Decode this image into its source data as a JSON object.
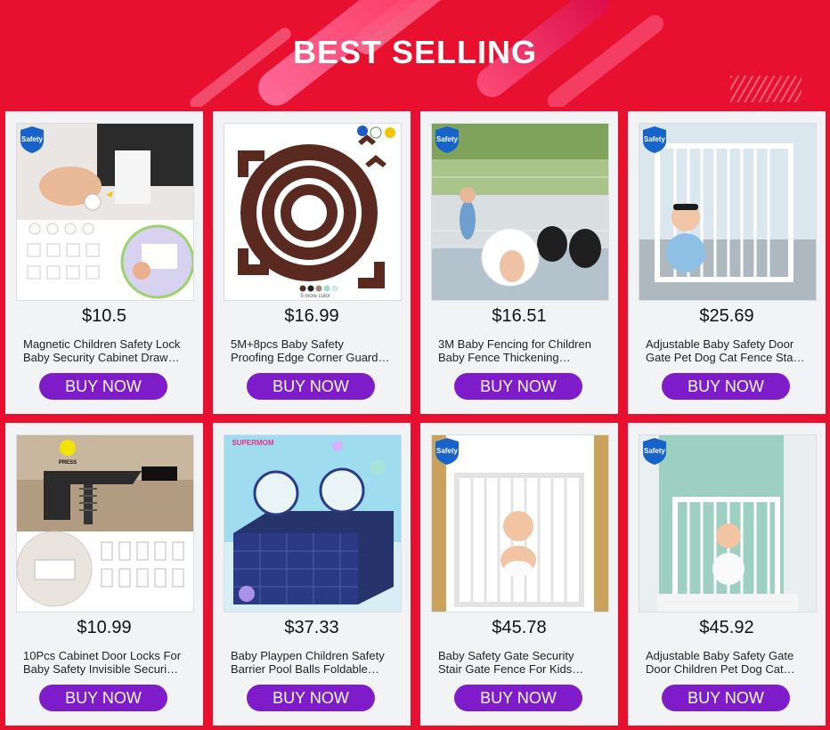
{
  "header": {
    "title": "BEST SELLING"
  },
  "colors": {
    "background": "#e8102f",
    "button": "#7d1cc8",
    "card": "#f2f3f5"
  },
  "products": [
    {
      "price": "$10.5",
      "name_line1": "Magnetic Children Safety Lock",
      "name_line2": "Baby Security Cabinet Draw…",
      "button": "BUY NOW",
      "badge": "Safety"
    },
    {
      "price": "$16.99",
      "name_line1": "5M+8pcs Baby Safety",
      "name_line2": "Proofing Edge Corner Guard…",
      "button": "BUY NOW",
      "badge": "",
      "swatch_text": "5 more color"
    },
    {
      "price": "$16.51",
      "name_line1": "3M Baby Fencing for Children",
      "name_line2": "Baby Fence Thickening…",
      "button": "BUY NOW",
      "badge": "Safety"
    },
    {
      "price": "$25.69",
      "name_line1": "Adjustable Baby Safety Door",
      "name_line2": "Gate Pet Dog Cat Fence Sta…",
      "button": "BUY NOW",
      "badge": "Safety"
    },
    {
      "price": "$10.99",
      "name_line1": "10Pcs Cabinet Door Locks For",
      "name_line2": "Baby Safety Invisible Securi…",
      "button": "BUY NOW",
      "badge": "",
      "press_text": "PRESS"
    },
    {
      "price": "$37.33",
      "name_line1": "Baby Playpen Children Safety",
      "name_line2": "Barrier Pool Balls Foldable…",
      "button": "BUY NOW",
      "badge": "",
      "brand_text": "SUPERMOM"
    },
    {
      "price": "$45.78",
      "name_line1": "Baby Safety Gate Security",
      "name_line2": "Stair Gate Fence For Kids…",
      "button": "BUY NOW",
      "badge": "Safety"
    },
    {
      "price": "$45.92",
      "name_line1": "Adjustable Baby Safety Gate",
      "name_line2": "Door Children Pet Dog Cat…",
      "button": "BUY NOW",
      "badge": "Safety"
    }
  ]
}
